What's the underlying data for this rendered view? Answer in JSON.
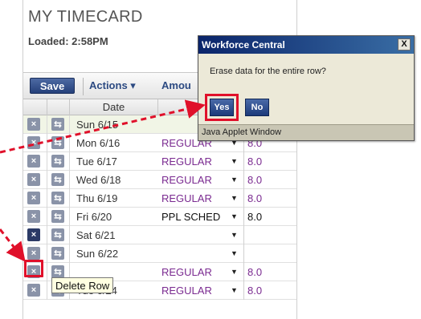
{
  "timecard": {
    "title": "MY TIMECARD",
    "loaded_label": "Loaded: 2:58PM"
  },
  "toolbar": {
    "save_label": "Save",
    "actions_label": "Actions ▾",
    "amount_label": "Amou"
  },
  "grid": {
    "date_header": "Date",
    "pay_header": "P",
    "rows": [
      {
        "date": "Sun 6/15",
        "pay": "",
        "amount": ""
      },
      {
        "date": "Mon 6/16",
        "pay": "REGULAR",
        "amount": "8.0"
      },
      {
        "date": "Tue 6/17",
        "pay": "REGULAR",
        "amount": "8.0"
      },
      {
        "date": "Wed 6/18",
        "pay": "REGULAR",
        "amount": "8.0"
      },
      {
        "date": "Thu 6/19",
        "pay": "REGULAR",
        "amount": "8.0"
      },
      {
        "date": "Fri 6/20",
        "pay": "PPL SCHED",
        "amount": "8.0"
      },
      {
        "date": "Sat 6/21",
        "pay": "",
        "amount": ""
      },
      {
        "date": "Sun 6/22",
        "pay": "",
        "amount": ""
      },
      {
        "date": "",
        "pay": "REGULAR",
        "amount": "8.0"
      },
      {
        "date": "Tue 6/24",
        "pay": "REGULAR",
        "amount": "8.0"
      }
    ]
  },
  "tooltip": {
    "text": "Delete Row"
  },
  "dialog": {
    "title": "Workforce Central",
    "close_label": "X",
    "message": "Erase data for the entire row?",
    "yes_label": "Yes",
    "no_label": "No",
    "footer": "Java Applet Window"
  },
  "icons": {
    "delete_row": "x-icon",
    "insert_row": "add-row-icon",
    "dropdown": "triangle-down-icon"
  },
  "colors": {
    "highlight": "#e0102a",
    "dialog_title_bg": "#0a246a",
    "pay_code_text": "#7a2a90",
    "save_button_bg": "#25407a"
  }
}
